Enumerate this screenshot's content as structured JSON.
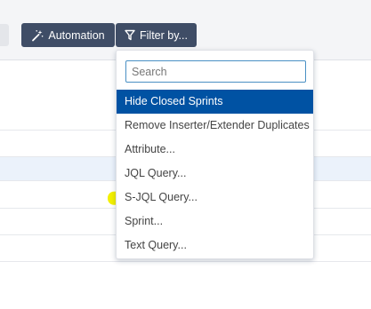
{
  "toolbar": {
    "automation_label": "Automation",
    "filter_label": "Filter by...",
    "automation_icon": "magic-wand-icon",
    "filter_icon": "funnel-icon"
  },
  "dropdown": {
    "search_placeholder": "Search",
    "items": [
      {
        "label": "Hide Closed Sprints",
        "active": true
      },
      {
        "label": "Remove Inserter/Extender Duplicates"
      },
      {
        "label": "Attribute..."
      },
      {
        "label": "JQL Query..."
      },
      {
        "label": "S-JQL Query...",
        "highlighted": true
      },
      {
        "label": "Sprint..."
      },
      {
        "label": "Text Query..."
      }
    ]
  },
  "colors": {
    "toolbar_button": "#3f4d66",
    "active_item": "#0052a3",
    "highlight_marker": "#f3f000",
    "row_highlight": "#ebf2fb"
  }
}
